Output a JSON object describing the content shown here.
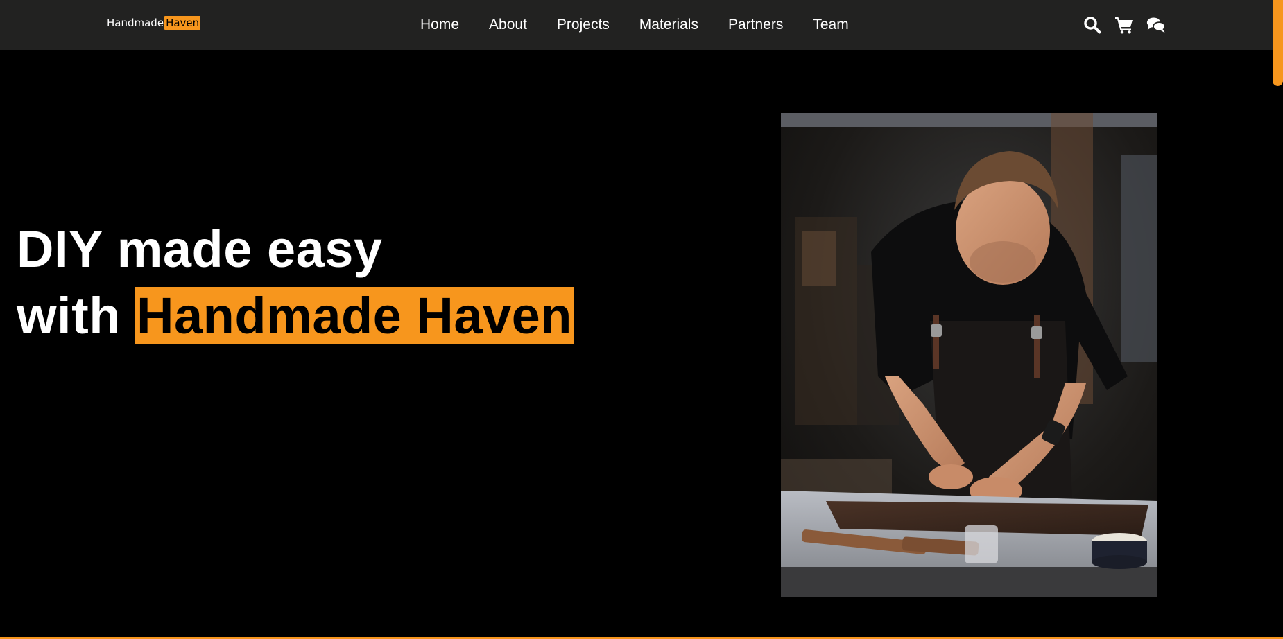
{
  "brand": {
    "name_part1": "Handmade",
    "name_part2": "Haven",
    "accent_color": "#f7961d"
  },
  "nav": {
    "links": [
      {
        "label": "Home"
      },
      {
        "label": "About"
      },
      {
        "label": "Projects"
      },
      {
        "label": "Materials"
      },
      {
        "label": "Partners"
      },
      {
        "label": "Team"
      }
    ],
    "icons": [
      "search-icon",
      "cart-icon",
      "chat-icon"
    ]
  },
  "hero": {
    "line1": "DIY made easy",
    "line2_prefix": "with ",
    "line2_highlight": "Handmade Haven",
    "image": {
      "icon": "craftsman-photo"
    }
  },
  "colors": {
    "navbar_bg": "#222221",
    "page_bg": "#000000",
    "accent": "#f7961d"
  }
}
